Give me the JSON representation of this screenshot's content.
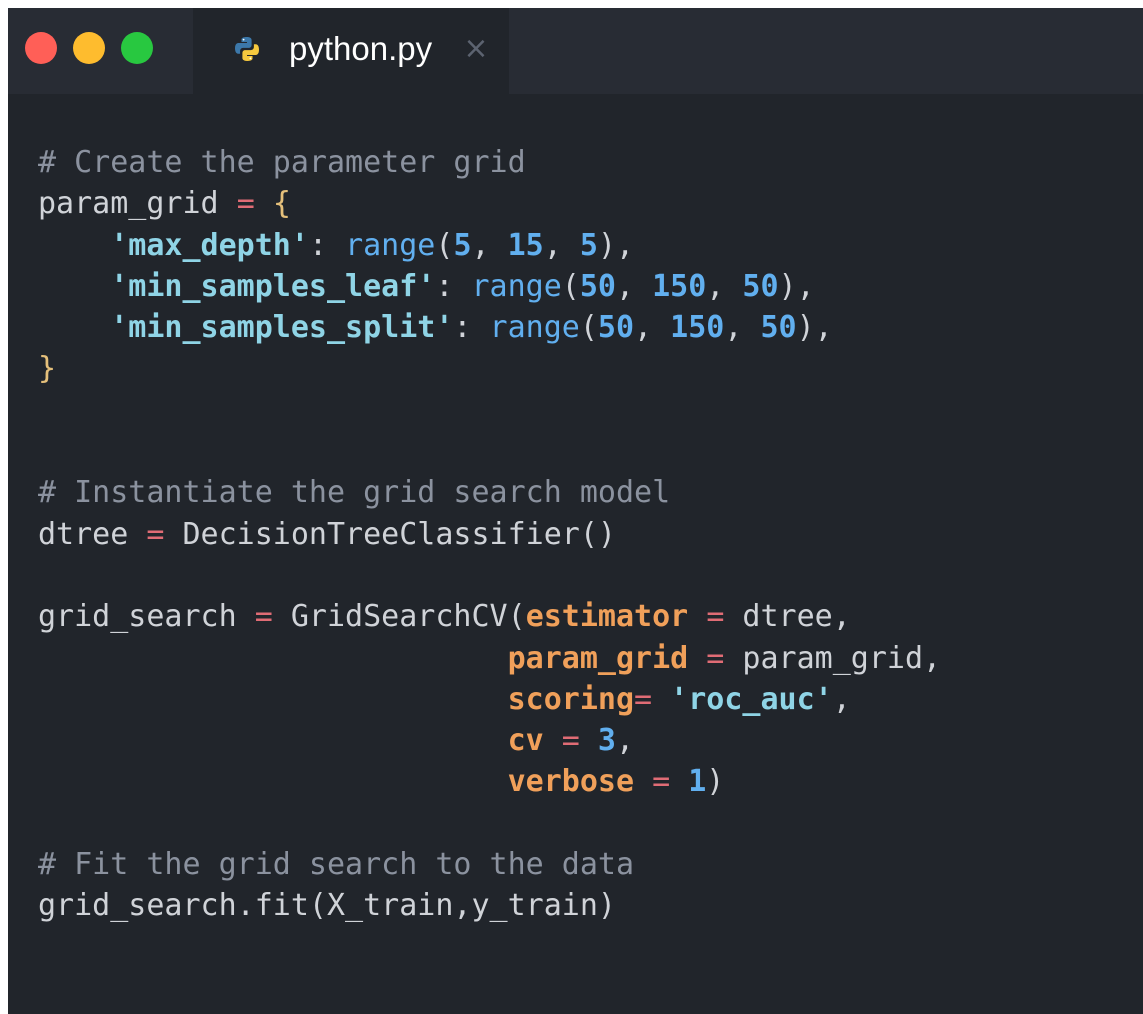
{
  "window": {
    "controls": [
      "close-dot",
      "minimize-dot",
      "maximize-dot"
    ]
  },
  "colors": {
    "close": "#ff5f57",
    "minimize": "#febc2e",
    "maximize": "#28c840",
    "background": "#21252b",
    "titlebar": "#282c34",
    "comment": "#8b929f",
    "operator": "#e06c75",
    "string": "#8fd4e6",
    "number": "#61afef",
    "keyword_arg": "#f0a05a"
  },
  "tab": {
    "filename": "python.py",
    "icon": "python-icon",
    "close_glyph": "×"
  },
  "code": {
    "lines": [
      [
        {
          "t": "# Create the parameter grid",
          "c": "comment"
        }
      ],
      [
        {
          "t": "param_grid "
        },
        {
          "t": "=",
          "c": "op"
        },
        {
          "t": " "
        },
        {
          "t": "{",
          "c": "brace"
        }
      ],
      [
        {
          "t": "    "
        },
        {
          "t": "'max_depth'",
          "c": "str"
        },
        {
          "t": ": "
        },
        {
          "t": "range",
          "c": "fn"
        },
        {
          "t": "("
        },
        {
          "t": "5",
          "c": "num"
        },
        {
          "t": ", "
        },
        {
          "t": "15",
          "c": "num"
        },
        {
          "t": ", "
        },
        {
          "t": "5",
          "c": "num"
        },
        {
          "t": "),"
        }
      ],
      [
        {
          "t": "    "
        },
        {
          "t": "'min_samples_leaf'",
          "c": "str"
        },
        {
          "t": ": "
        },
        {
          "t": "range",
          "c": "fn"
        },
        {
          "t": "("
        },
        {
          "t": "50",
          "c": "num"
        },
        {
          "t": ", "
        },
        {
          "t": "150",
          "c": "num"
        },
        {
          "t": ", "
        },
        {
          "t": "50",
          "c": "num"
        },
        {
          "t": "),"
        }
      ],
      [
        {
          "t": "    "
        },
        {
          "t": "'min_samples_split'",
          "c": "str"
        },
        {
          "t": ": "
        },
        {
          "t": "range",
          "c": "fn"
        },
        {
          "t": "("
        },
        {
          "t": "50",
          "c": "num"
        },
        {
          "t": ", "
        },
        {
          "t": "150",
          "c": "num"
        },
        {
          "t": ", "
        },
        {
          "t": "50",
          "c": "num"
        },
        {
          "t": "),"
        }
      ],
      [
        {
          "t": "}",
          "c": "brace"
        }
      ],
      [],
      [],
      [
        {
          "t": "# Instantiate the grid search model",
          "c": "comment"
        }
      ],
      [
        {
          "t": "dtree "
        },
        {
          "t": "=",
          "c": "op"
        },
        {
          "t": " DecisionTreeClassifier()"
        }
      ],
      [],
      [
        {
          "t": "grid_search "
        },
        {
          "t": "=",
          "c": "op"
        },
        {
          "t": " GridSearchCV("
        },
        {
          "t": "estimator",
          "c": "kw"
        },
        {
          "t": " "
        },
        {
          "t": "=",
          "c": "op"
        },
        {
          "t": " dtree,"
        }
      ],
      [
        {
          "t": "                          "
        },
        {
          "t": "param_grid",
          "c": "kw"
        },
        {
          "t": " "
        },
        {
          "t": "=",
          "c": "op"
        },
        {
          "t": " param_grid,"
        }
      ],
      [
        {
          "t": "                          "
        },
        {
          "t": "scoring",
          "c": "kw"
        },
        {
          "t": "=",
          "c": "op"
        },
        {
          "t": " "
        },
        {
          "t": "'roc_auc'",
          "c": "str"
        },
        {
          "t": ","
        }
      ],
      [
        {
          "t": "                          "
        },
        {
          "t": "cv",
          "c": "kw"
        },
        {
          "t": " "
        },
        {
          "t": "=",
          "c": "op"
        },
        {
          "t": " "
        },
        {
          "t": "3",
          "c": "num"
        },
        {
          "t": ","
        }
      ],
      [
        {
          "t": "                          "
        },
        {
          "t": "verbose",
          "c": "kw"
        },
        {
          "t": " "
        },
        {
          "t": "=",
          "c": "op"
        },
        {
          "t": " "
        },
        {
          "t": "1",
          "c": "num"
        },
        {
          "t": ")"
        }
      ],
      [],
      [
        {
          "t": "# Fit the grid search to the data",
          "c": "comment"
        }
      ],
      [
        {
          "t": "grid_search.fit(X_train,y_train)"
        }
      ]
    ]
  }
}
